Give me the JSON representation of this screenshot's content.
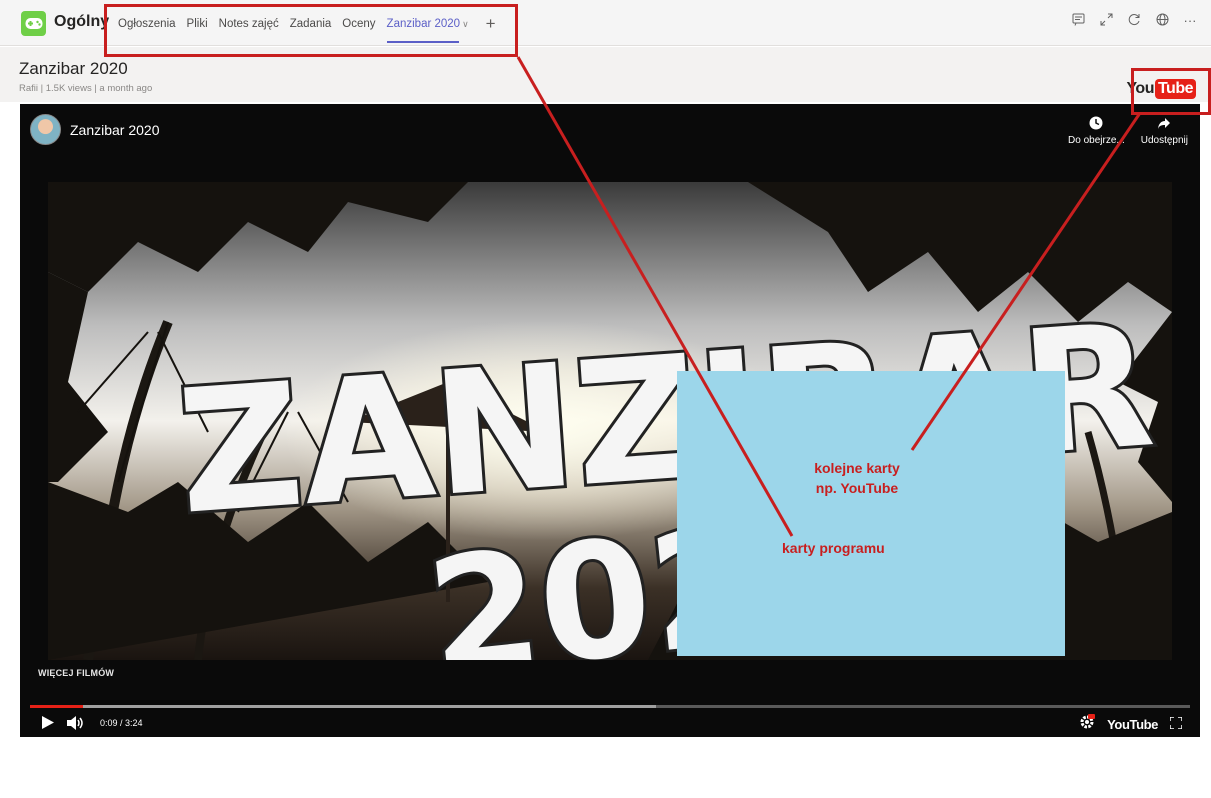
{
  "topbar": {
    "channel": "Ogólny",
    "tabs": [
      "Ogłoszenia",
      "Pliki",
      "Notes zajęć",
      "Zadania",
      "Oceny"
    ],
    "active_tab": "Zanzibar 2020",
    "add_tab_icon": "plus-icon",
    "right_icons": [
      "conversation-icon",
      "expand-icon",
      "refresh-icon",
      "globe-icon",
      "more-icon"
    ],
    "more_label": "···"
  },
  "header": {
    "title": "Zanzibar 2020",
    "meta": "Rafii | 1.5K views | a month ago",
    "logo_you": "You",
    "logo_tube": "Tube"
  },
  "player": {
    "title": "Zanzibar 2020",
    "watch_later": "Do obejrze...",
    "share": "Udostępnij",
    "big_title": "ZANZIBAR",
    "big_year": "202",
    "more_videos": "WIĘCEJ FILMÓW",
    "time": "0:09 / 3:24",
    "played_fraction": 0.046,
    "buffered_fraction": 0.54,
    "yt_small": "YouTube"
  },
  "annotations": {
    "next_tabs_line1": "kolejne karty",
    "next_tabs_line2": "np. YouTube",
    "program_tabs": "karty programu",
    "color": "#c81f1f"
  },
  "colors": {
    "accent": "#5b5fc7",
    "youtube_red": "#e62117",
    "overlay": "#9cd6ea"
  }
}
